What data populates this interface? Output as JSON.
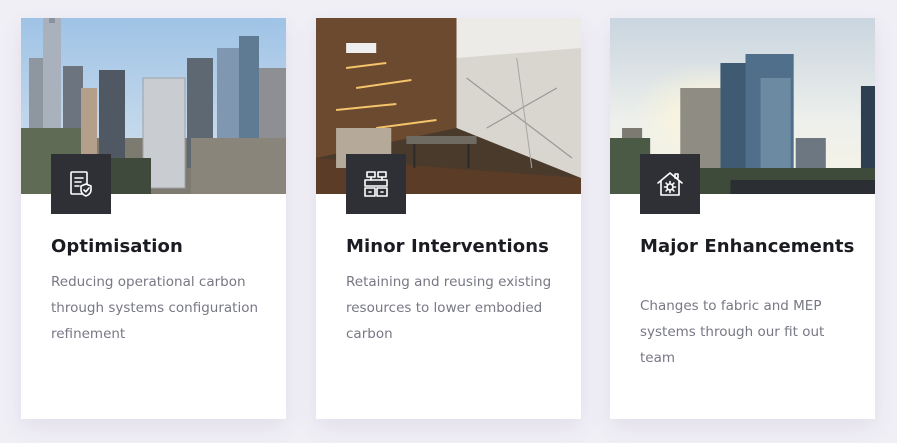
{
  "cards": [
    {
      "title": "Optimisation",
      "description": "Reducing operational carbon through systems configuration refinement",
      "icon": "checklist-shield-icon",
      "image": "city-skyline-photo"
    },
    {
      "title": "Minor Interventions",
      "description": "Retaining and reusing existing resources to lower embodied carbon",
      "icon": "building-blocks-icon",
      "image": "office-interior-photo"
    },
    {
      "title": "Major Enhancements",
      "description": "Changes to fabric and MEP systems through our fit out team",
      "icon": "house-gear-icon",
      "image": "glass-towers-photo"
    }
  ],
  "colors": {
    "page_background": "#f1eff6",
    "card_background": "#ffffff",
    "icon_box": "#2f3036",
    "title": "#1b1c22",
    "body_text": "#777884"
  }
}
